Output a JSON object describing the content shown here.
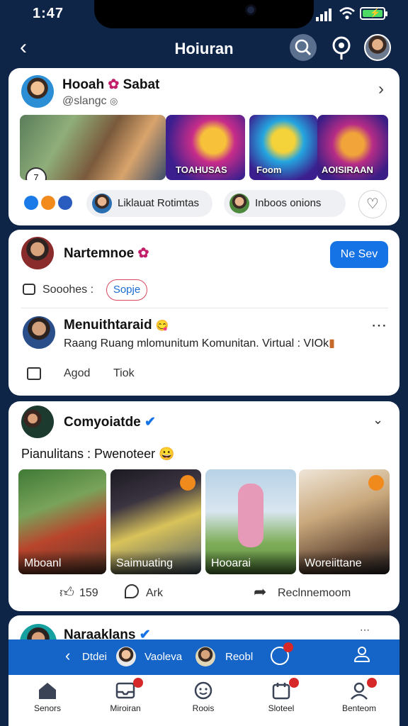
{
  "status": {
    "time": "1:47"
  },
  "header": {
    "title": "Hoiuran"
  },
  "card1": {
    "name": "Hooah",
    "name_extra": "Sabat",
    "handle": "@slangc",
    "photo_labels": [
      "TOAHUSAS",
      "Foom",
      "AOISIRAAN"
    ],
    "chip1": "Liklauat Rotimtas",
    "chip2": "Inboos onions"
  },
  "card2": {
    "name": "Nartemnoe",
    "button": "Ne Sev",
    "field_label": "Sooohes :",
    "tag": "Sopje",
    "post_name": "Menuithtaraid",
    "post_text": "Raang Ruang mlomunitum Komunitan. Virtual : VIOk",
    "action1": "Agod",
    "action2": "Tiok"
  },
  "card3": {
    "name": "Comyoiatde",
    "caption": "Pianulitans : Pwenoteer",
    "tiles": [
      "Mboanl",
      "Saimuating",
      "Hooarai",
      "Woreiittane"
    ],
    "like_count": "159",
    "comment_label": "Ark",
    "share_label": "Reclnnemoom"
  },
  "card4": {
    "name": "Naraaklans"
  },
  "bluebar": {
    "item1": "Dtdei",
    "item2": "Vaoleva",
    "item3": "Reobl"
  },
  "tabs": [
    {
      "label": "Senors"
    },
    {
      "label": "Miroiran"
    },
    {
      "label": "Roois"
    },
    {
      "label": "Sloteel"
    },
    {
      "label": "Benteom"
    }
  ],
  "colors": {
    "brand_blue": "#1573e5",
    "bar_blue": "#1565c8",
    "bg": "#0f2548",
    "badge_red": "#d62828"
  }
}
